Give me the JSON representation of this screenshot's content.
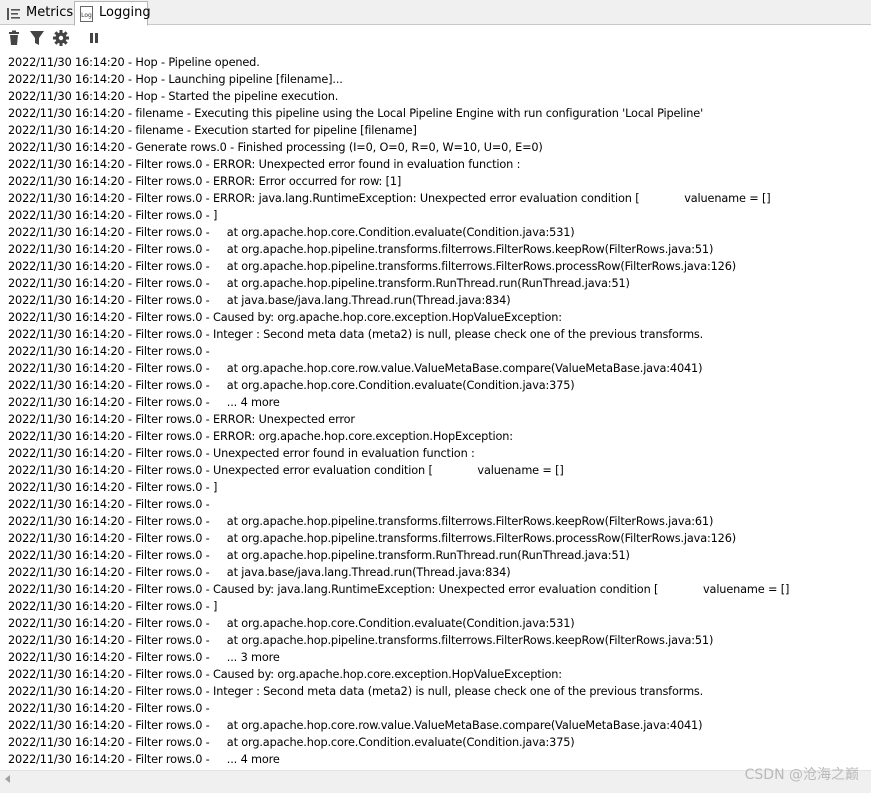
{
  "tabs": [
    {
      "label": "Metrics",
      "icon": "metrics-icon"
    },
    {
      "label": "Logging",
      "icon": "log-icon",
      "icon_text": "Log"
    }
  ],
  "toolbar": [
    {
      "icon": "trash-icon"
    },
    {
      "icon": "filter-icon"
    },
    {
      "icon": "gear-icon"
    },
    {
      "icon": "pause-icon"
    }
  ],
  "log_lines": [
    "2022/11/30 16:14:20 - Hop - Pipeline opened.",
    "2022/11/30 16:14:20 - Hop - Launching pipeline [filename]...",
    "2022/11/30 16:14:20 - Hop - Started the pipeline execution.",
    "2022/11/30 16:14:20 - filename - Executing this pipeline using the Local Pipeline Engine with run configuration 'Local Pipeline'",
    "2022/11/30 16:14:20 - filename - Execution started for pipeline [filename]",
    "2022/11/30 16:14:20 - Generate rows.0 - Finished processing (I=0, O=0, R=0, W=10, U=0, E=0)",
    "2022/11/30 16:14:20 - Filter rows.0 - ERROR: Unexpected error found in evaluation function :",
    "2022/11/30 16:14:20 - Filter rows.0 - ERROR: Error occurred for row: [1]",
    "2022/11/30 16:14:20 - Filter rows.0 - ERROR: java.lang.RuntimeException: Unexpected error evaluation condition [             valuename = []",
    "2022/11/30 16:14:20 - Filter rows.0 - ]",
    "2022/11/30 16:14:20 - Filter rows.0 -     at org.apache.hop.core.Condition.evaluate(Condition.java:531)",
    "2022/11/30 16:14:20 - Filter rows.0 -     at org.apache.hop.pipeline.transforms.filterrows.FilterRows.keepRow(FilterRows.java:51)",
    "2022/11/30 16:14:20 - Filter rows.0 -     at org.apache.hop.pipeline.transforms.filterrows.FilterRows.processRow(FilterRows.java:126)",
    "2022/11/30 16:14:20 - Filter rows.0 -     at org.apache.hop.pipeline.transform.RunThread.run(RunThread.java:51)",
    "2022/11/30 16:14:20 - Filter rows.0 -     at java.base/java.lang.Thread.run(Thread.java:834)",
    "2022/11/30 16:14:20 - Filter rows.0 - Caused by: org.apache.hop.core.exception.HopValueException:",
    "2022/11/30 16:14:20 - Filter rows.0 - Integer : Second meta data (meta2) is null, please check one of the previous transforms.",
    "2022/11/30 16:14:20 - Filter rows.0 -",
    "2022/11/30 16:14:20 - Filter rows.0 -     at org.apache.hop.core.row.value.ValueMetaBase.compare(ValueMetaBase.java:4041)",
    "2022/11/30 16:14:20 - Filter rows.0 -     at org.apache.hop.core.Condition.evaluate(Condition.java:375)",
    "2022/11/30 16:14:20 - Filter rows.0 -     ... 4 more",
    "2022/11/30 16:14:20 - Filter rows.0 - ERROR: Unexpected error",
    "2022/11/30 16:14:20 - Filter rows.0 - ERROR: org.apache.hop.core.exception.HopException:",
    "2022/11/30 16:14:20 - Filter rows.0 - Unexpected error found in evaluation function :",
    "2022/11/30 16:14:20 - Filter rows.0 - Unexpected error evaluation condition [             valuename = []",
    "2022/11/30 16:14:20 - Filter rows.0 - ]",
    "2022/11/30 16:14:20 - Filter rows.0 -",
    "2022/11/30 16:14:20 - Filter rows.0 -     at org.apache.hop.pipeline.transforms.filterrows.FilterRows.keepRow(FilterRows.java:61)",
    "2022/11/30 16:14:20 - Filter rows.0 -     at org.apache.hop.pipeline.transforms.filterrows.FilterRows.processRow(FilterRows.java:126)",
    "2022/11/30 16:14:20 - Filter rows.0 -     at org.apache.hop.pipeline.transform.RunThread.run(RunThread.java:51)",
    "2022/11/30 16:14:20 - Filter rows.0 -     at java.base/java.lang.Thread.run(Thread.java:834)",
    "2022/11/30 16:14:20 - Filter rows.0 - Caused by: java.lang.RuntimeException: Unexpected error evaluation condition [             valuename = []",
    "2022/11/30 16:14:20 - Filter rows.0 - ]",
    "2022/11/30 16:14:20 - Filter rows.0 -     at org.apache.hop.core.Condition.evaluate(Condition.java:531)",
    "2022/11/30 16:14:20 - Filter rows.0 -     at org.apache.hop.pipeline.transforms.filterrows.FilterRows.keepRow(FilterRows.java:51)",
    "2022/11/30 16:14:20 - Filter rows.0 -     ... 3 more",
    "2022/11/30 16:14:20 - Filter rows.0 - Caused by: org.apache.hop.core.exception.HopValueException:",
    "2022/11/30 16:14:20 - Filter rows.0 - Integer : Second meta data (meta2) is null, please check one of the previous transforms.",
    "2022/11/30 16:14:20 - Filter rows.0 -",
    "2022/11/30 16:14:20 - Filter rows.0 -     at org.apache.hop.core.row.value.ValueMetaBase.compare(ValueMetaBase.java:4041)",
    "2022/11/30 16:14:20 - Filter rows.0 -     at org.apache.hop.core.Condition.evaluate(Condition.java:375)",
    "2022/11/30 16:14:20 - Filter rows.0 -     ... 4 more"
  ],
  "watermark": "CSDN @沧海之巅",
  "colors": {
    "tab_bar": "#f0f0f0",
    "icon": "#444444",
    "log_text": "#000000",
    "watermark": "#b9b9b9"
  }
}
